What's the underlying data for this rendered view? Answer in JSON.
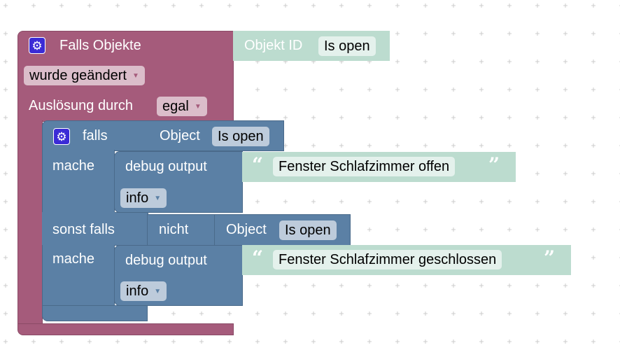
{
  "colors": {
    "event": "#a55b7b",
    "logic": "#5b80a5",
    "text": "#bcdccf"
  },
  "event": {
    "title": "Falls Objekte",
    "trigger": "wurde geändert",
    "trigger_by_label": "Auslösung durch",
    "trigger_by": "egal",
    "object_label": "Objekt ID",
    "object_value": "Is open"
  },
  "if_block": {
    "if_label": "falls",
    "do_label": "mache",
    "elseif_label": "sonst falls",
    "do2_label": "mache",
    "cond1": {
      "label": "Object",
      "value": "Is open"
    },
    "not_label": "nicht",
    "cond2": {
      "label": "Object",
      "value": "Is open"
    }
  },
  "debug1": {
    "label": "debug output",
    "level": "info",
    "text": "Fenster Schlafzimmer offen"
  },
  "debug2": {
    "label": "debug output",
    "level": "info",
    "text": "Fenster Schlafzimmer geschlossen"
  },
  "icons": {
    "gear": "gear-icon",
    "dropdown": "triangle-down-icon",
    "quote_open": "“",
    "quote_close": "”"
  }
}
